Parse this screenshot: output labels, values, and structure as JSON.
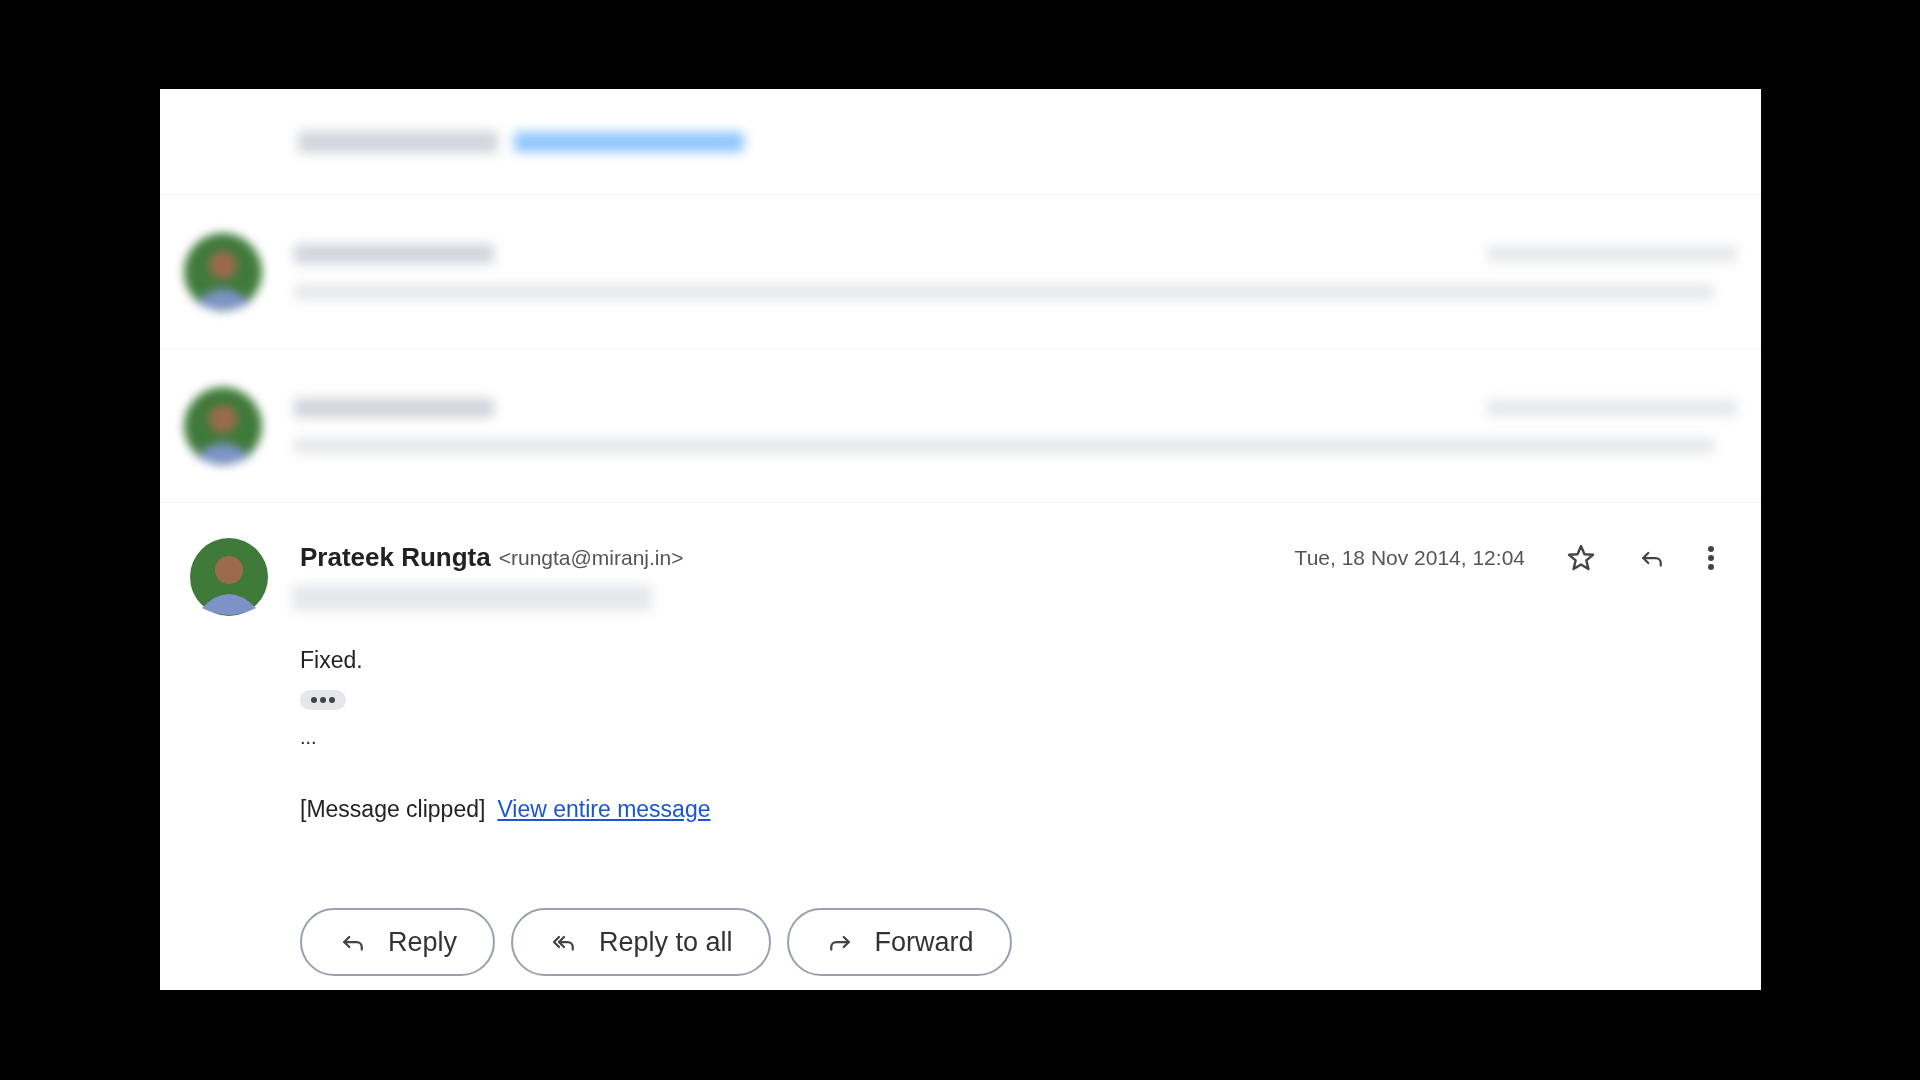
{
  "collapsed_messages": [
    {
      "kind": "blurred"
    },
    {
      "kind": "blurred"
    }
  ],
  "message": {
    "sender_name": "Prateek Rungta",
    "sender_email": "<rungta@miranj.in>",
    "date": "Tue, 18 Nov 2014, 12:04",
    "starred": false,
    "body": "Fixed.",
    "ellipsis": "...",
    "clipped_note": "[Message clipped]",
    "clipped_link": "View entire message"
  },
  "actions": [
    {
      "kind": "reply",
      "label": "Reply"
    },
    {
      "kind": "reply_all",
      "label": "Reply to all"
    },
    {
      "kind": "forward",
      "label": "Forward"
    }
  ]
}
